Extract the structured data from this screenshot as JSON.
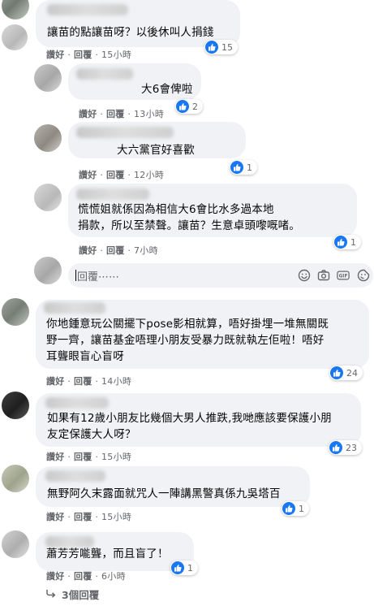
{
  "comments": [
    {
      "text": "讓苗的點讓苗呀？以後休叫人捐錢",
      "like": "讚好",
      "reply": "回覆",
      "time": "15小時",
      "reactions": "15"
    },
    {
      "text": "大6會俾啦",
      "like": "讚好",
      "reply": "回覆",
      "time": "13小時",
      "reactions": "2"
    },
    {
      "text": "大六黨官好喜歡",
      "like": "讚好",
      "reply": "回覆",
      "time": "12小時",
      "reactions": "1"
    },
    {
      "text": "慌慌姐就係因為相信大6會比水多過本地\n捐款，所以至禁聲。讓苗？生意卓頭嚟嘅啫。",
      "like": "讚好",
      "reply": "回覆",
      "time": "7小時",
      "reactions": "1"
    },
    {
      "text": "你地鍾意玩公關擺下pose影相就算，唔好掛埋一堆無關既\n野一齊，讓苗基金唔理小朋友受暴力既就執左佢啦！唔好\n耳聾眼盲心盲呀",
      "like": "讚好",
      "reply": "回覆",
      "time": "14小時",
      "reactions": "24"
    },
    {
      "text": "如果有12歲小朋友比幾個大男人推跌,我哋應該要保護小朋\n友定保護大人呀？",
      "like": "讚好",
      "reply": "回覆",
      "time": "15小時",
      "reactions": "23"
    },
    {
      "text": "無野阿久末露面就咒人一陣講黑警真係九吳塔百",
      "like": "讚好",
      "reply": "回覆",
      "time": "15小時",
      "reactions": "1"
    },
    {
      "text": "蕭芳芳𠹌聾，而且盲了！",
      "like": "讚好",
      "reply": "回覆",
      "time": "6小時",
      "reactions": "1"
    }
  ],
  "reply_input": {
    "placeholder": "回覆⋯⋯"
  },
  "more_replies": "3個回覆",
  "colors": {
    "bubble": "#f0f2f5",
    "like_blue": "#1877f2",
    "meta_gray": "#65676b"
  }
}
